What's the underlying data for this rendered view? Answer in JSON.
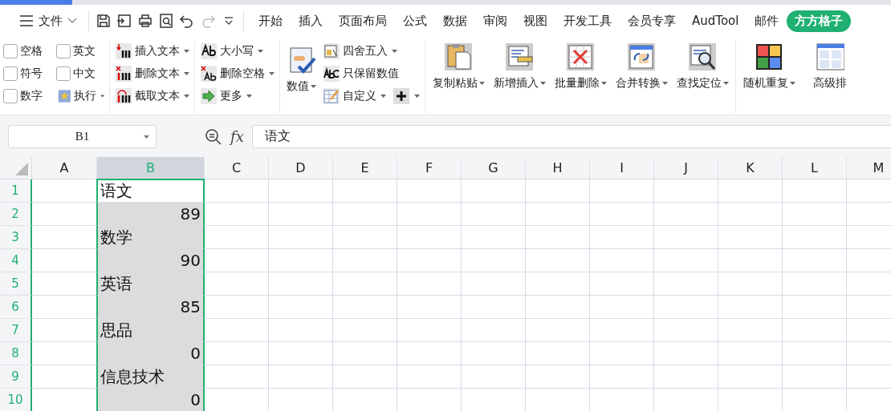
{
  "menu": {
    "file": "文件",
    "tabs": [
      {
        "label": "开始",
        "selected": false
      },
      {
        "label": "插入",
        "selected": false
      },
      {
        "label": "页面布局",
        "selected": false
      },
      {
        "label": "公式",
        "selected": false
      },
      {
        "label": "数据",
        "selected": false
      },
      {
        "label": "审阅",
        "selected": false
      },
      {
        "label": "视图",
        "selected": false
      },
      {
        "label": "开发工具",
        "selected": false
      },
      {
        "label": "会员专享",
        "selected": false
      },
      {
        "label": "AudTool",
        "selected": false
      },
      {
        "label": "邮件",
        "selected": false
      },
      {
        "label": "方方格子",
        "selected": true
      }
    ]
  },
  "ribbon": {
    "groups": [
      {
        "rows": [
          [
            {
              "kind": "checkbox",
              "label": "空格",
              "checked": false
            },
            {
              "kind": "checkbox",
              "label": "英文",
              "checked": false
            }
          ],
          [
            {
              "kind": "checkbox",
              "label": "符号",
              "checked": false
            },
            {
              "kind": "checkbox",
              "label": "中文",
              "checked": false
            }
          ],
          [
            {
              "kind": "checkbox",
              "label": "数字",
              "checked": false
            },
            {
              "kind": "button",
              "label": "执行",
              "has_menu": true
            }
          ]
        ]
      },
      {
        "rows": [
          [
            {
              "kind": "button",
              "label": "插入文本",
              "has_menu": true
            }
          ],
          [
            {
              "kind": "button",
              "label": "删除文本",
              "has_menu": true
            }
          ],
          [
            {
              "kind": "button",
              "label": "截取文本",
              "has_menu": true
            }
          ]
        ]
      },
      {
        "rows": [
          [
            {
              "kind": "button",
              "label": "大小写",
              "has_menu": true
            }
          ],
          [
            {
              "kind": "button",
              "label": "删除空格",
              "has_menu": true
            }
          ],
          [
            {
              "kind": "button",
              "label": "更多",
              "has_menu": true
            }
          ]
        ]
      },
      {
        "big": [
          {
            "label": "数值",
            "has_menu": true
          }
        ],
        "rows": [
          [
            {
              "kind": "button",
              "label": "四舍五入",
              "has_menu": true
            }
          ],
          [
            {
              "kind": "button",
              "label": "只保留数值",
              "has_menu": false
            }
          ],
          [
            {
              "kind": "button",
              "label": "自定义",
              "has_menu": true
            },
            {
              "kind": "icon-button",
              "has_menu": true
            }
          ]
        ]
      },
      {
        "big": [
          {
            "label": "复制粘贴",
            "has_menu": true
          },
          {
            "label": "新增插入",
            "has_menu": true
          },
          {
            "label": "批量删除",
            "has_menu": true
          },
          {
            "label": "合并转换",
            "has_menu": true
          },
          {
            "label": "查找定位",
            "has_menu": true
          }
        ]
      },
      {
        "big": [
          {
            "label": "随机重复",
            "has_menu": true
          },
          {
            "label": "高级排",
            "has_menu": false
          }
        ]
      }
    ]
  },
  "formula_bar": {
    "name_box": "B1",
    "function_label": "fx",
    "formula": "语文"
  },
  "sheet": {
    "columns": [
      {
        "label": "A",
        "selected": false
      },
      {
        "label": "B",
        "selected": true,
        "cells": [
          {
            "kind": "text",
            "value": "语文",
            "active": true
          },
          {
            "kind": "number",
            "value": "89",
            "active": false
          },
          {
            "kind": "text",
            "value": "数学",
            "active": false
          },
          {
            "kind": "number",
            "value": "90",
            "active": false
          },
          {
            "kind": "text",
            "value": "英语",
            "active": false
          },
          {
            "kind": "number",
            "value": "85",
            "active": false
          },
          {
            "kind": "text",
            "value": "思品",
            "active": false
          },
          {
            "kind": "number",
            "value": "0",
            "active": false
          },
          {
            "kind": "text",
            "value": "信息技术",
            "active": false
          },
          {
            "kind": "number",
            "value": "0",
            "active": false
          }
        ]
      },
      {
        "label": "C",
        "selected": false
      },
      {
        "label": "D",
        "selected": false
      },
      {
        "label": "E",
        "selected": false
      },
      {
        "label": "F",
        "selected": false
      },
      {
        "label": "G",
        "selected": false
      },
      {
        "label": "H",
        "selected": false
      },
      {
        "label": "I",
        "selected": false
      },
      {
        "label": "J",
        "selected": false
      },
      {
        "label": "K",
        "selected": false
      },
      {
        "label": "L",
        "selected": false
      },
      {
        "label": "M",
        "selected": false
      }
    ],
    "rows": [
      {
        "label": "1",
        "selected": true
      },
      {
        "label": "2",
        "selected": true
      },
      {
        "label": "3",
        "selected": true
      },
      {
        "label": "4",
        "selected": true
      },
      {
        "label": "5",
        "selected": true
      },
      {
        "label": "6",
        "selected": true
      },
      {
        "label": "7",
        "selected": true
      },
      {
        "label": "8",
        "selected": true
      },
      {
        "label": "9",
        "selected": true
      },
      {
        "label": "10",
        "selected": true
      }
    ]
  }
}
